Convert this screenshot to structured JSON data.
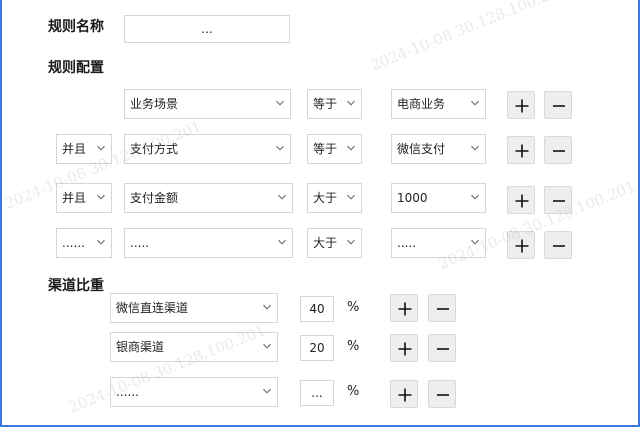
{
  "rule_name": {
    "label": "规则名称",
    "value": "..."
  },
  "rule_config": {
    "label": "规则配置",
    "rows": [
      {
        "logic": "",
        "field": "业务场景",
        "operator": "等于",
        "value": "电商业务"
      },
      {
        "logic": "并且",
        "field": "支付方式",
        "operator": "等于",
        "value": "微信支付"
      },
      {
        "logic": "并且",
        "field": "支付金额",
        "operator": "大于",
        "value": "1000"
      },
      {
        "logic": "......",
        "field": ".....",
        "operator": "大于",
        "value": "....."
      }
    ]
  },
  "channel_weight": {
    "label": "渠道比重",
    "rows": [
      {
        "channel": "微信直连渠道",
        "weight": "40",
        "unit": "%"
      },
      {
        "channel": "银商渠道",
        "weight": "20",
        "unit": "%"
      },
      {
        "channel": "......",
        "weight": "...",
        "unit": "%"
      }
    ]
  },
  "watermark": {
    "text": "2024-10-08 30.128.100.201"
  },
  "icons": {
    "add": "plus-icon",
    "remove": "minus-icon",
    "dropdown": "chevron-down-icon"
  },
  "colors": {
    "frame_accent": "#3c78e4",
    "button_bg": "#eeeeee",
    "border": "#d6d6d6"
  }
}
